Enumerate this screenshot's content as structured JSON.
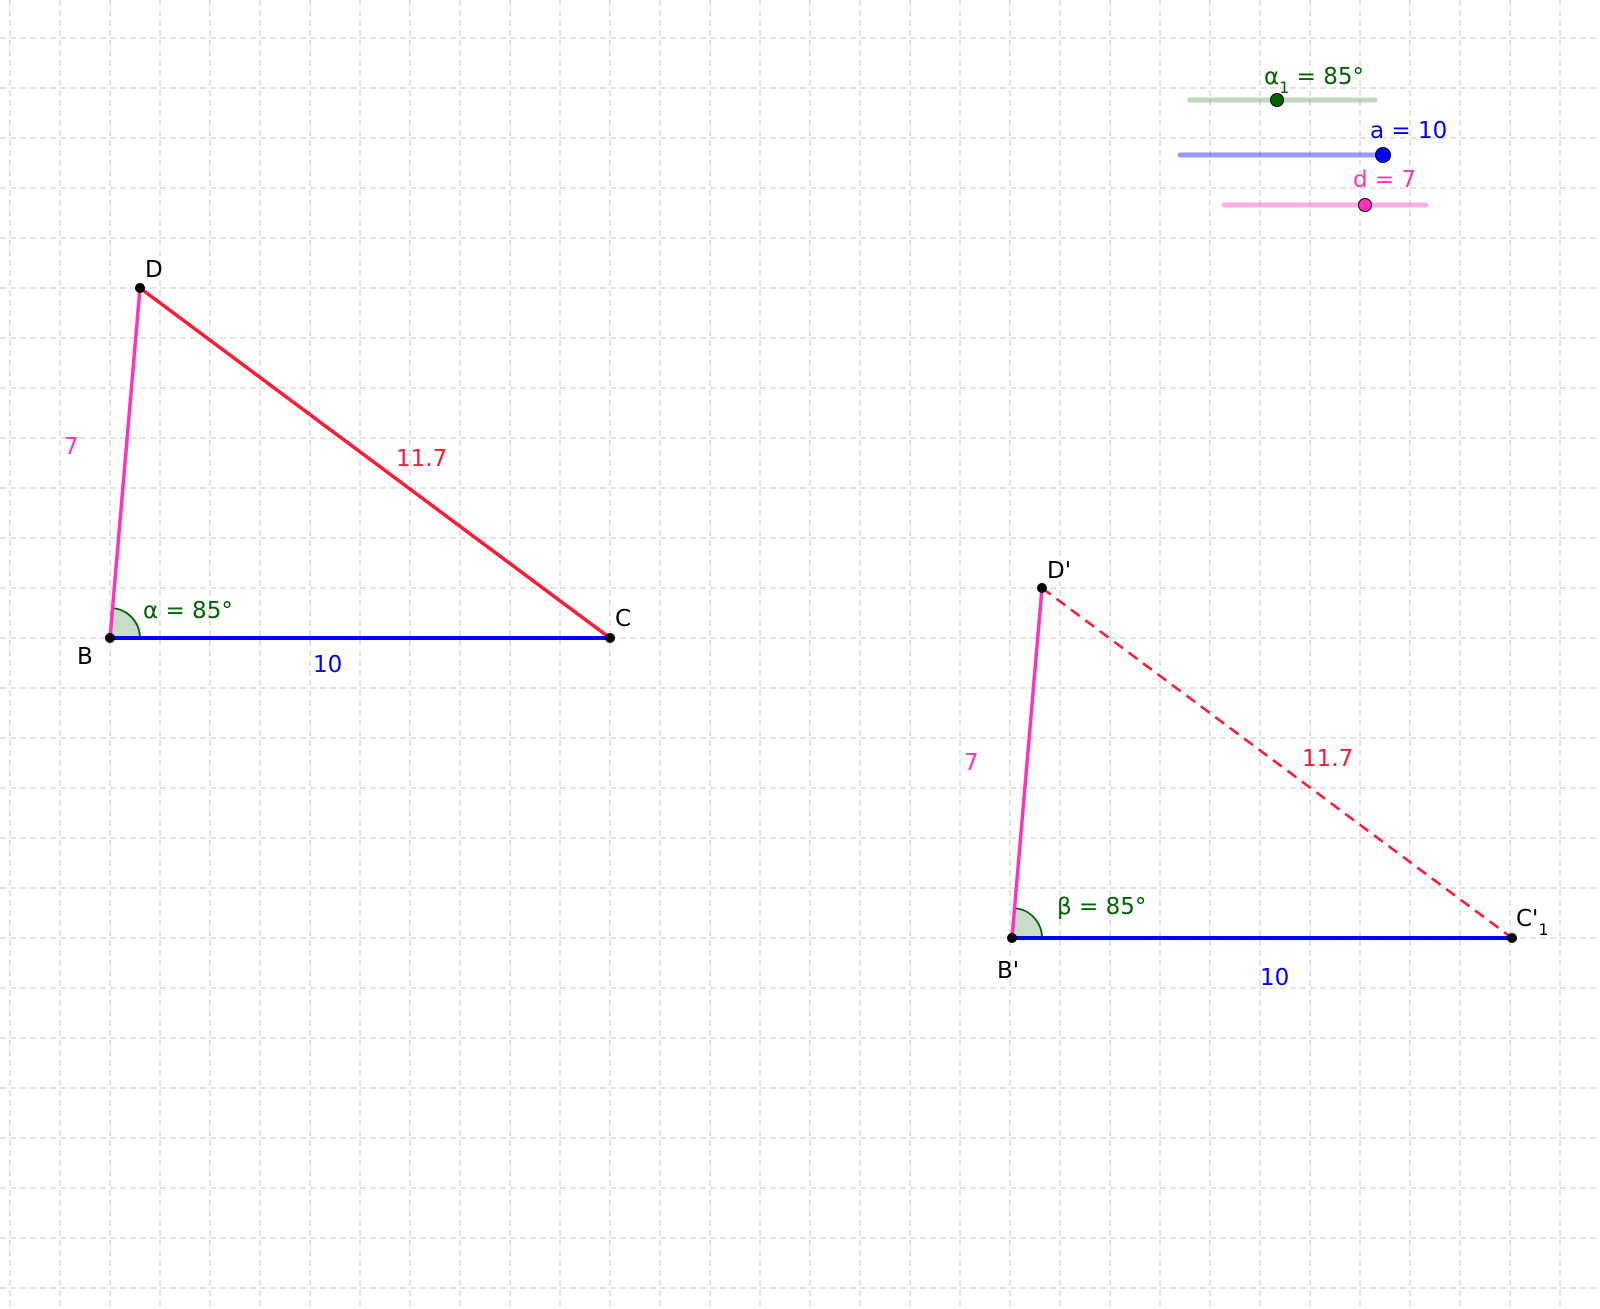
{
  "colors": {
    "grid": "#c8c8c8",
    "green": "#006400",
    "blue": "#0000ff",
    "pink": "#ff33bb",
    "red": "#ff1a33",
    "black": "#000000"
  },
  "sliders": {
    "alpha1": {
      "label": "α",
      "sub": "1",
      "rest": " = 85°",
      "value": 85
    },
    "a": {
      "label": "a = 10",
      "value": 10
    },
    "d": {
      "label": "d = 7",
      "value": 7
    }
  },
  "triangle1": {
    "points": {
      "B": "B",
      "C": "C",
      "D": "D"
    },
    "side_bc": "10",
    "side_bd": "7",
    "side_dc": "11.7",
    "angle": "α = 85°"
  },
  "triangle2": {
    "points": {
      "B": "B'",
      "C": "C'",
      "C_sub": "1",
      "D": "D'"
    },
    "side_bc": "10",
    "side_bd": "7",
    "side_dc": "11.7",
    "angle": "β = 85°"
  }
}
